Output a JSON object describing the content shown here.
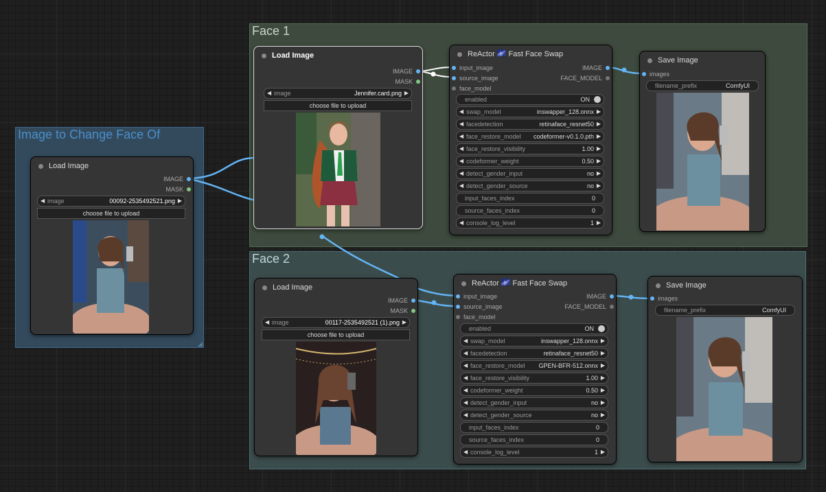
{
  "groups": {
    "face1": {
      "title": "Face 1"
    },
    "face2": {
      "title": "Face 2"
    },
    "change": {
      "title": "Image to Change Face Of"
    }
  },
  "nodes": {
    "load_target": {
      "title": "Load Image",
      "outputs": [
        "IMAGE",
        "MASK"
      ],
      "image_label": "image",
      "image_value": "00092-2535492521.png",
      "upload_label": "choose file to upload"
    },
    "load_face1": {
      "title": "Load Image",
      "outputs": [
        "IMAGE",
        "MASK"
      ],
      "image_label": "image",
      "image_value": "Jennifer.card.png",
      "upload_label": "choose file to upload"
    },
    "load_face2": {
      "title": "Load Image",
      "outputs": [
        "IMAGE",
        "MASK"
      ],
      "image_label": "image",
      "image_value": "00117-2535492521 (1).png",
      "upload_label": "choose file to upload"
    },
    "reactor1": {
      "title": "ReActor 🌌 Fast Face Swap",
      "inputs": [
        "input_image",
        "source_image",
        "face_model"
      ],
      "outputs": [
        "IMAGE",
        "FACE_MODEL"
      ],
      "widgets": [
        {
          "label": "enabled",
          "value": "ON",
          "kind": "toggle"
        },
        {
          "label": "swap_model",
          "value": "inswapper_128.onnx",
          "kind": "combo"
        },
        {
          "label": "facedetection",
          "value": "retinaface_resnet50",
          "kind": "combo"
        },
        {
          "label": "face_restore_model",
          "value": "codeformer-v0.1.0.pth",
          "kind": "combo"
        },
        {
          "label": "face_restore_visibility",
          "value": "1.00",
          "kind": "combo"
        },
        {
          "label": "codeformer_weight",
          "value": "0.50",
          "kind": "combo"
        },
        {
          "label": "detect_gender_input",
          "value": "no",
          "kind": "combo"
        },
        {
          "label": "detect_gender_source",
          "value": "no",
          "kind": "combo"
        },
        {
          "label": "input_faces_index",
          "value": "0",
          "kind": "text"
        },
        {
          "label": "source_faces_index",
          "value": "0",
          "kind": "text"
        },
        {
          "label": "console_log_level",
          "value": "1",
          "kind": "combo"
        }
      ]
    },
    "reactor2": {
      "title": "ReActor 🌌 Fast Face Swap",
      "inputs": [
        "input_image",
        "source_image",
        "face_model"
      ],
      "outputs": [
        "IMAGE",
        "FACE_MODEL"
      ],
      "widgets": [
        {
          "label": "enabled",
          "value": "ON",
          "kind": "toggle"
        },
        {
          "label": "swap_model",
          "value": "inswapper_128.onnx",
          "kind": "combo"
        },
        {
          "label": "facedetection",
          "value": "retinaface_resnet50",
          "kind": "combo"
        },
        {
          "label": "face_restore_model",
          "value": "GPEN-BFR-512.onnx",
          "kind": "combo"
        },
        {
          "label": "face_restore_visibility",
          "value": "1.00",
          "kind": "combo"
        },
        {
          "label": "codeformer_weight",
          "value": "0.50",
          "kind": "combo"
        },
        {
          "label": "detect_gender_input",
          "value": "no",
          "kind": "combo"
        },
        {
          "label": "detect_gender_source",
          "value": "no",
          "kind": "combo"
        },
        {
          "label": "input_faces_index",
          "value": "0",
          "kind": "text"
        },
        {
          "label": "source_faces_index",
          "value": "0",
          "kind": "text"
        },
        {
          "label": "console_log_level",
          "value": "1",
          "kind": "combo"
        }
      ]
    },
    "save1": {
      "title": "Save Image",
      "inputs": [
        "images"
      ],
      "prefix_label": "filename_prefix",
      "prefix_value": "ComfyUI"
    },
    "save2": {
      "title": "Save Image",
      "inputs": [
        "images"
      ],
      "prefix_label": "filename_prefix",
      "prefix_value": "ComfyUI"
    }
  },
  "colors": {
    "image_link": "#64b5f6",
    "mask_socket": "#81c784",
    "face1_group": "#3d4a3d",
    "face2_group": "#3b4c4c",
    "change_group": "#334a5c"
  },
  "icons": {
    "toggle_knob": "circle-knob-icon",
    "combo_left": "left-arrow-icon",
    "combo_right": "right-arrow-icon"
  }
}
